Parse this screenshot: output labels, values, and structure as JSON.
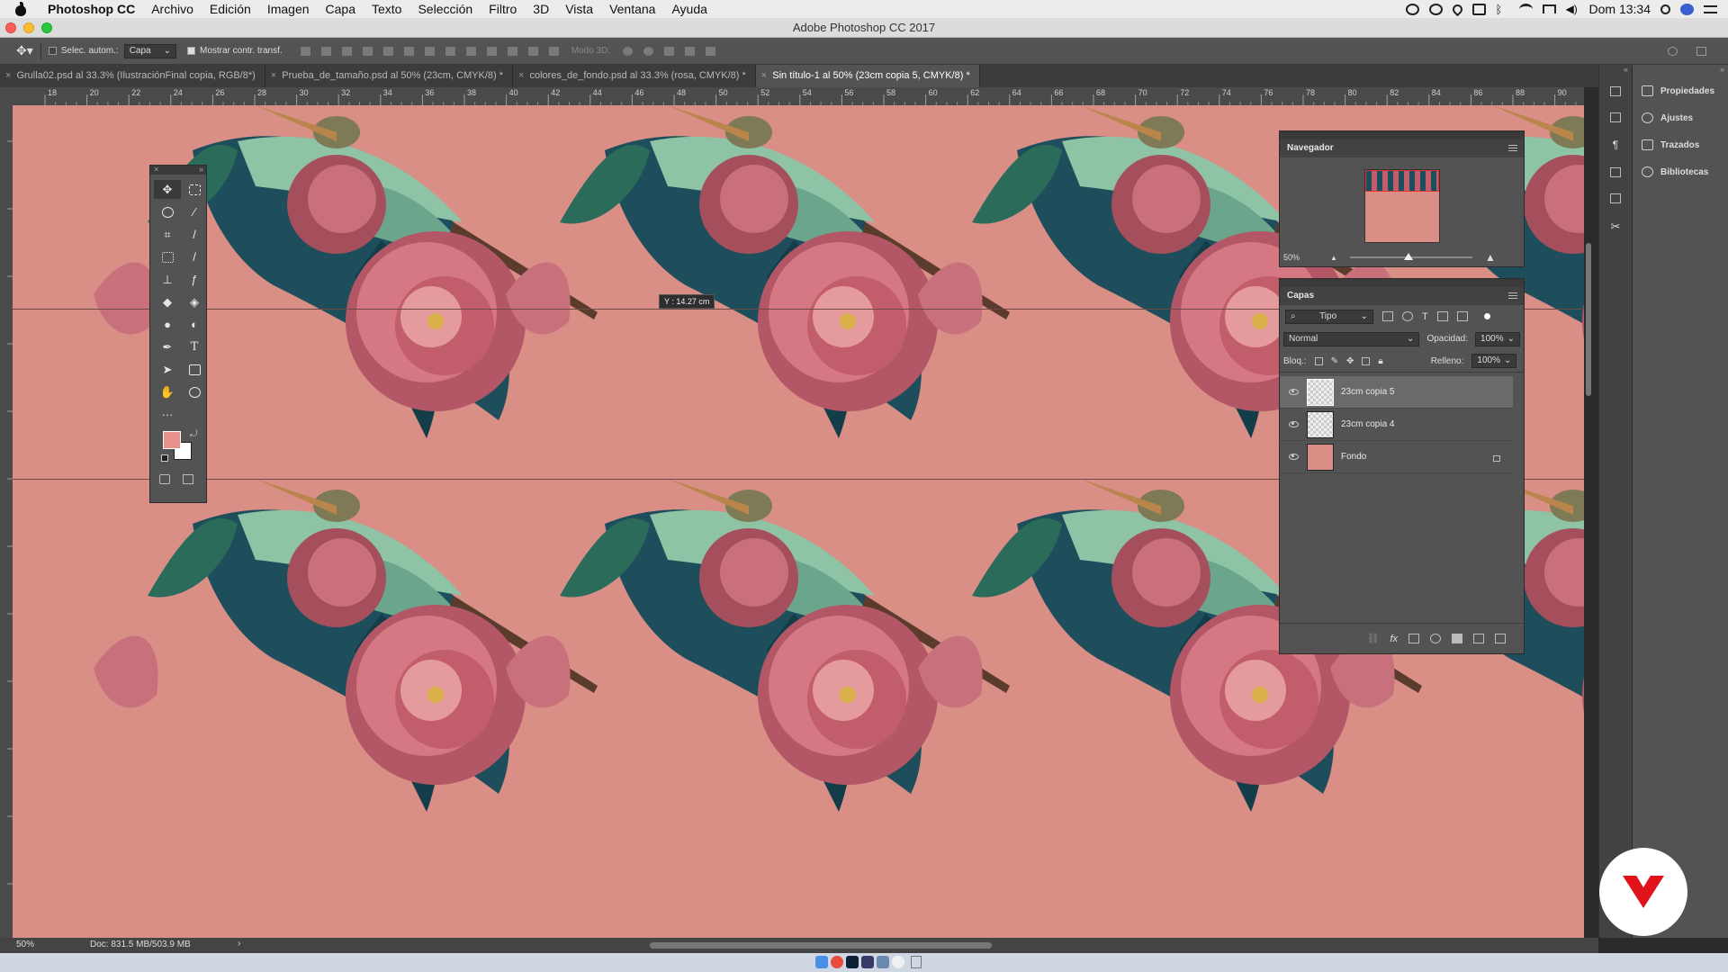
{
  "menubar": {
    "app_name": "Photoshop CC",
    "items": [
      "Archivo",
      "Edición",
      "Imagen",
      "Capa",
      "Texto",
      "Selección",
      "Filtro",
      "3D",
      "Vista",
      "Ventana",
      "Ayuda"
    ],
    "clock": "Dom 13:34"
  },
  "window": {
    "title": "Adobe Photoshop CC 2017"
  },
  "options": {
    "auto_select_label": "Selec. autom.:",
    "auto_select_value": "Capa",
    "show_transform_label": "Mostrar contr. transf.",
    "mode3d_label": "Modo 3D:"
  },
  "tabs": [
    {
      "label": "Grulla02.psd al 33.3% (IlustraciónFinal copia, RGB/8*)",
      "active": false
    },
    {
      "label": "Prueba_de_tamaño.psd al 50% (23cm, CMYK/8) *",
      "active": false
    },
    {
      "label": "colores_de_fondo.psd al 33.3% (rosa, CMYK/8) *",
      "active": false
    },
    {
      "label": "Sin título-1 al 50% (23cm copia 5, CMYK/8) *",
      "active": true
    }
  ],
  "ruler": {
    "ticks": [
      "18",
      "20",
      "22",
      "24",
      "26",
      "28",
      "30",
      "32",
      "34",
      "36",
      "38",
      "40",
      "42",
      "44",
      "46",
      "48",
      "50",
      "52",
      "54",
      "56",
      "58",
      "60",
      "62",
      "64",
      "66",
      "68",
      "70",
      "72",
      "74",
      "76",
      "78",
      "80",
      "82",
      "84",
      "86",
      "88",
      "90"
    ]
  },
  "tooltip": {
    "text": "Y : 14.27 cm"
  },
  "navigator": {
    "title": "Navegador",
    "zoom": "50%"
  },
  "layers": {
    "title": "Capas",
    "kind_filter": "Tipo",
    "blend_mode": "Normal",
    "opacity_label": "Opacidad:",
    "opacity_value": "100%",
    "lock_label": "Bloq.:",
    "fill_label": "Relleno:",
    "fill_value": "100%",
    "items": [
      {
        "name": "23cm copia 5",
        "selected": true
      },
      {
        "name": "23cm copia 4",
        "selected": false
      },
      {
        "name": "Fondo",
        "selected": false,
        "locked": true
      }
    ],
    "footer_fx": "fx"
  },
  "right_panel": {
    "items": [
      "Propiedades",
      "Ajustes",
      "Trazados",
      "Bibliotecas"
    ]
  },
  "status": {
    "zoom": "50%",
    "doc": "Doc: 831.5 MB/503.9 MB"
  },
  "colors": {
    "canvas_bg": "#d98e86",
    "foreground": "#e8908a",
    "background": "#ffffff",
    "brand": "#e0121a"
  },
  "canvas_description_icons": [
    "heron-icon",
    "peony-icon",
    "leaf-icon"
  ]
}
